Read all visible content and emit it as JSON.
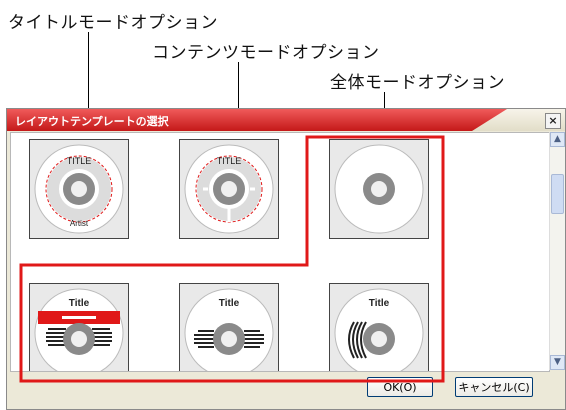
{
  "callouts": {
    "title_mode": "タイトルモードオプション",
    "contents_mode": "コンテンツモードオプション",
    "all_mode": "全体モードオプション"
  },
  "dialog": {
    "title": "レイアウトテンプレートの選択",
    "close": "×",
    "ok_label": "OK(O)",
    "cancel_label": "キャンセル(C)"
  },
  "templates": {
    "t1": {
      "title": "TITLE",
      "artist": "Artist"
    },
    "t2": {
      "title": "TITLE"
    },
    "t4": {
      "title": "Title"
    },
    "t5": {
      "title": "Title"
    },
    "t6": {
      "title": "Title"
    }
  },
  "colors": {
    "accent": "#e01818",
    "titlebar": "#d42020"
  }
}
